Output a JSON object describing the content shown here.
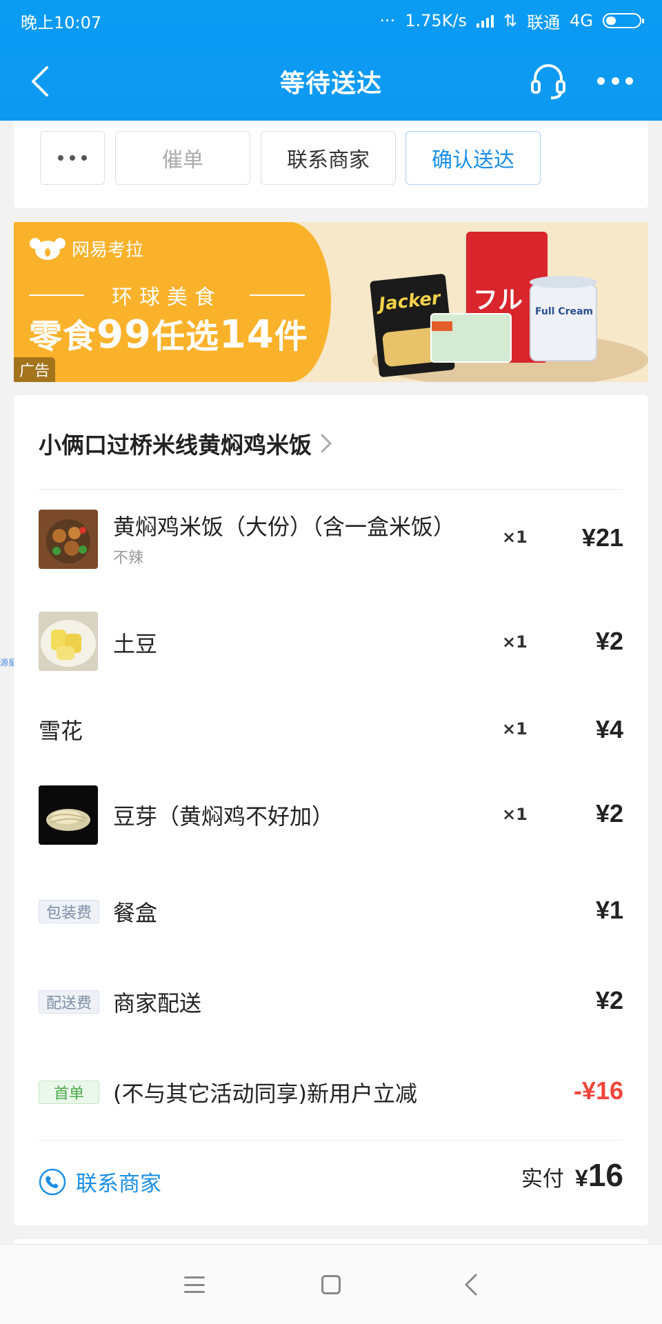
{
  "status_bar": {
    "time": "晚上10:07",
    "speed": "1.75K/s",
    "carrier": "联通",
    "network": "4G"
  },
  "header": {
    "title": "等待送达"
  },
  "actions": {
    "more_label": "···",
    "urge": "催单",
    "contact_merchant": "联系商家",
    "confirm_delivery": "确认送达"
  },
  "ad": {
    "brand": "网易考拉",
    "subtitle": "环球美食",
    "headline_pre": "零食",
    "headline_num1": "99",
    "headline_mid": "任选",
    "headline_num2": "14",
    "headline_post": "件",
    "tag": "广告",
    "pkg_jacker": "Jacker",
    "pkg_calbee": "フル",
    "pkg_can": "Full Cream"
  },
  "order": {
    "store_name": "小俩口过桥米线黄焖鸡米饭",
    "items": [
      {
        "name": "黄焖鸡米饭（大份）（含一盒米饭）",
        "note": "不辣",
        "qty": "×1",
        "price": "¥21"
      },
      {
        "name": "土豆",
        "qty": "×1",
        "price": "¥2"
      },
      {
        "name": "雪花",
        "qty": "×1",
        "price": "¥4"
      },
      {
        "name": "豆芽（黄焖鸡不好加）",
        "qty": "×1",
        "price": "¥2"
      }
    ],
    "fees": [
      {
        "tag": "包装费",
        "name": "餐盒",
        "price": "¥1"
      },
      {
        "tag": "配送费",
        "name": "商家配送",
        "price": "¥2"
      },
      {
        "tag": "首单",
        "name": "(不与其它活动同享)新用户立减",
        "price": "-¥16"
      }
    ],
    "contact_label": "联系商家",
    "paid_label": "实付",
    "paid_currency": "¥",
    "paid_amount": "16"
  },
  "watermark": "源星社区",
  "colors": {
    "header_blue": "#0d99f2",
    "link_blue": "#1a8ee6",
    "discount_red": "#f0453a",
    "ad_orange": "#fbb22b"
  }
}
